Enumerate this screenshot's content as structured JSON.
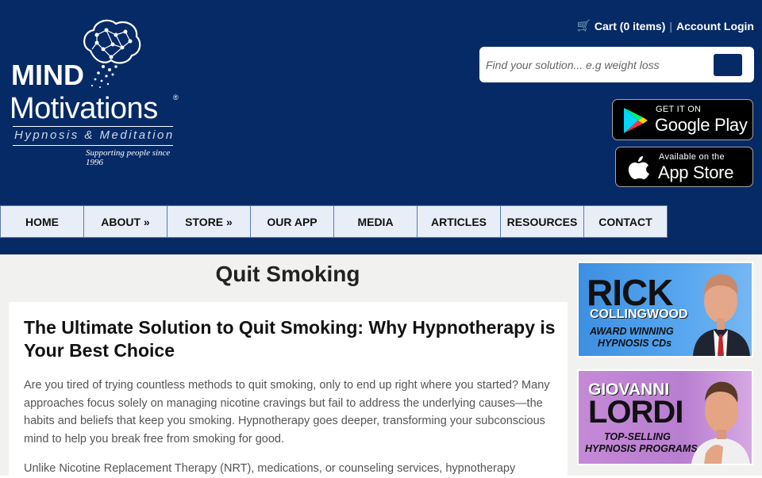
{
  "header": {
    "logo": {
      "line1": "MIND",
      "line2": "Motivations",
      "registered": "®",
      "tagline": "Hypnosis & Meditation",
      "since": "Supporting people since 1996"
    },
    "cart_label": "Cart (0 items)",
    "separator": "|",
    "account_label": "Account Login",
    "search": {
      "placeholder": "Find your solution... e.g weight loss"
    },
    "google_play": {
      "small": "GET IT ON",
      "big": "Google Play"
    },
    "app_store": {
      "small": "Available on the",
      "big": "App Store"
    }
  },
  "nav": [
    {
      "label": "HOME"
    },
    {
      "label": "ABOUT »"
    },
    {
      "label": "STORE »"
    },
    {
      "label": "OUR APP"
    },
    {
      "label": "MEDIA"
    },
    {
      "label": "ARTICLES"
    },
    {
      "label": "RESOURCES"
    },
    {
      "label": "CONTACT"
    }
  ],
  "main": {
    "title": "Quit Smoking",
    "heading": "The Ultimate Solution to Quit Smoking: Why Hypnotherapy is Your Best Choice",
    "paragraph1": "Are you tired of trying countless methods to quit smoking, only to end up right where you started? Many approaches focus solely on managing nicotine cravings but fail to address the underlying causes—the habits and beliefs that keep you smoking. Hypnotherapy goes deeper, transforming your subconscious mind to help you break free from smoking for good.",
    "paragraph2": "Unlike Nicotine Replacement Therapy (NRT), medications, or counseling services, hypnotherapy"
  },
  "sidebar": {
    "ad1": {
      "name_big": "RICK",
      "name_small": "COLLINGWOOD",
      "tag_line1": "AWARD WINNING",
      "tag_line2": "HYPNOSIS CDs"
    },
    "ad2": {
      "name_small": "GIOVANNI",
      "name_big": "LORDI",
      "tag_line1": "TOP-SELLING",
      "tag_line2": "HYPNOSIS PROGRAMS"
    }
  },
  "colors": {
    "header_bg": "#062a66",
    "nav_item_bg": "#e8eef7",
    "content_bg": "#f1f1ef"
  }
}
